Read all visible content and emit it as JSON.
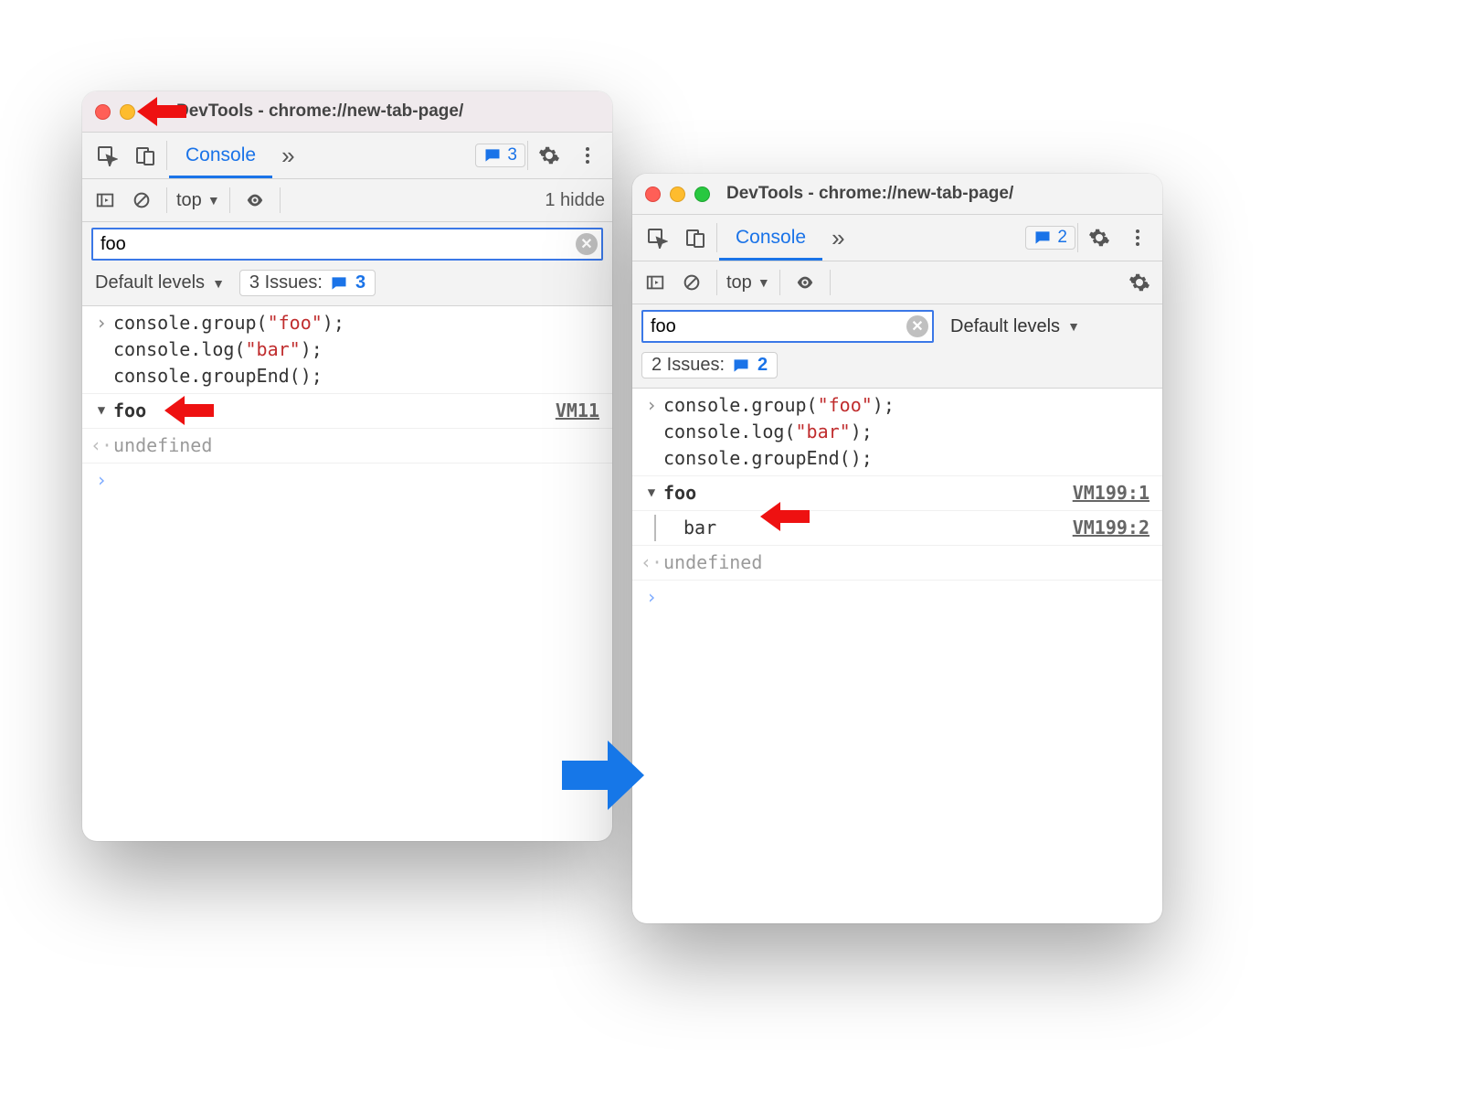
{
  "left": {
    "title": "DevTools - chrome://new-tab-page/",
    "tab_active": "Console",
    "badge_count": "3",
    "context_label": "top",
    "hidden_text": "1 hidde",
    "filter_value": "foo",
    "levels_label": "Default levels",
    "issues_label": "3 Issues:",
    "issues_count": "3",
    "code_line1_a": "console.group(",
    "code_line1_b": "\"foo\"",
    "code_line1_c": ");",
    "code_line2_a": "console.log(",
    "code_line2_b": "\"bar\"",
    "code_line2_c": ");",
    "code_line3": "console.groupEnd();",
    "group_label": "foo",
    "group_source": "VM11",
    "undefined_label": "undefined"
  },
  "right": {
    "title": "DevTools - chrome://new-tab-page/",
    "tab_active": "Console",
    "badge_count": "2",
    "context_label": "top",
    "filter_value": "foo",
    "levels_label": "Default levels",
    "issues_label": "2 Issues:",
    "issues_count": "2",
    "code_line1_a": "console.group(",
    "code_line1_b": "\"foo\"",
    "code_line1_c": ");",
    "code_line2_a": "console.log(",
    "code_line2_b": "\"bar\"",
    "code_line2_c": ");",
    "code_line3": "console.groupEnd();",
    "group_label": "foo",
    "group_source": "VM199:1",
    "child_label": "bar",
    "child_source": "VM199:2",
    "undefined_label": "undefined"
  }
}
